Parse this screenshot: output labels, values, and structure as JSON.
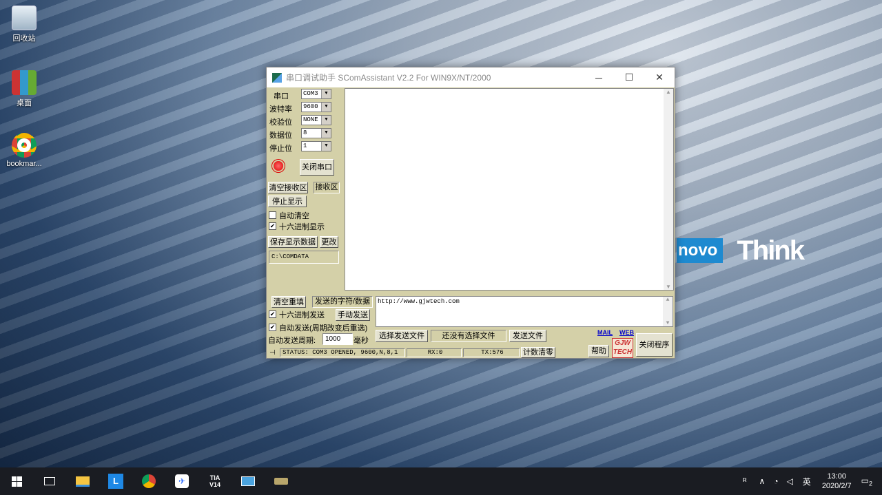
{
  "desktop": {
    "icons": [
      {
        "label": "回收站"
      },
      {
        "label": "桌面"
      },
      {
        "label": "bookmar..."
      }
    ],
    "brand_left": "novo",
    "brand_right": "Think"
  },
  "window": {
    "title": "串口调试助手 SComAssistant V2.2 For WIN9X/NT/2000",
    "controls": {
      "minimize": "─",
      "maximize": "☐",
      "close": "✕"
    },
    "port_settings": [
      {
        "label": "串口",
        "value": "COM3"
      },
      {
        "label": "波特率",
        "value": "9600"
      },
      {
        "label": "校验位",
        "value": "NONE"
      },
      {
        "label": "数据位",
        "value": "8"
      },
      {
        "label": "停止位",
        "value": "1"
      }
    ],
    "close_port_button": "关闭串口",
    "clear_recv_button": "清空接收区",
    "recv_area_label": "接收区",
    "stop_display_button": "停止显示",
    "auto_clear_label": "自动清空",
    "hex_display_label": "十六进制显示",
    "save_data_button": "保存显示数据",
    "change_button": "更改",
    "save_path": "C:\\COMDATA",
    "clear_resend_button": "清空重填",
    "send_label": "发送的字符/数据",
    "hex_send_label": "十六进制发送",
    "manual_send_button": "手动发送",
    "auto_send_label": "自动发送(周期改变后重选)",
    "period_label": "自动发送周期:",
    "period_value": "1000",
    "period_unit": "毫秒",
    "send_text": "http://www.gjwtech.com",
    "select_file_button": "选择发送文件",
    "no_file_text": "还没有选择文件",
    "send_file_button": "发送文件",
    "mail_link": "MAIL",
    "web_link": "WEB",
    "help_button": "帮助",
    "logo_text": "GJW TECH",
    "close_program_button": "关闭程序",
    "status": "STATUS: COM3 OPENED, 9600,N,8,1",
    "rx": "RX:0",
    "tx": "TX:576",
    "count_clear_button": "计数清零"
  },
  "taskbar": {
    "icons": [
      "windows-start",
      "task-view",
      "file-explorer",
      "L-app",
      "chrome",
      "feishu",
      "TIA V14",
      "app-6",
      "app-7"
    ],
    "tia_label": "TIA V14",
    "tray": {
      "ime": "英",
      "notif": "2",
      "time": "13:00",
      "date": "2020/2/7"
    }
  }
}
